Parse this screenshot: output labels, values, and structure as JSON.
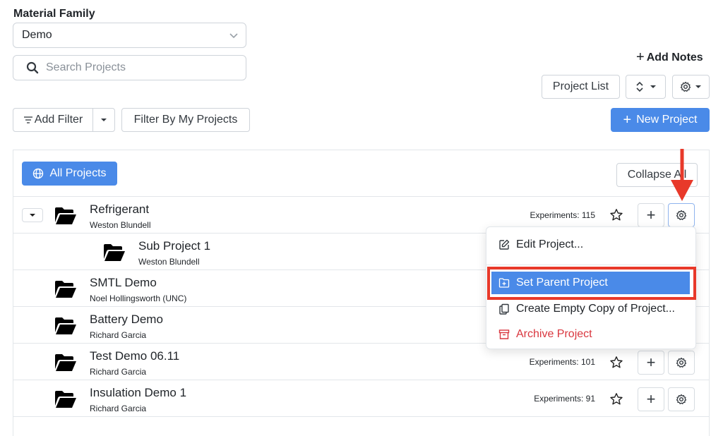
{
  "material_family": {
    "label": "Material Family",
    "selected": "Demo"
  },
  "search": {
    "placeholder": "Search Projects"
  },
  "add_notes_label": "Add Notes",
  "toolbar": {
    "project_list_label": "Project List"
  },
  "filters": {
    "add_filter_label": "Add Filter",
    "my_projects_label": "Filter By My Projects"
  },
  "new_project_label": "New Project",
  "panel": {
    "all_projects_label": "All Projects",
    "collapse_all_label": "Collapse All"
  },
  "projects": [
    {
      "name": "Refrigerant",
      "owner": "Weston Blundell",
      "experiments": "Experiments: 115"
    },
    {
      "name": "Sub Project 1",
      "owner": "Weston Blundell",
      "experiments": ""
    },
    {
      "name": "SMTL Demo",
      "owner": "Noel Hollingsworth (UNC)",
      "experiments": ""
    },
    {
      "name": "Battery Demo",
      "owner": "Richard Garcia",
      "experiments": ""
    },
    {
      "name": "Test Demo 06.11",
      "owner": "Richard Garcia",
      "experiments": "Experiments: 101"
    },
    {
      "name": "Insulation Demo 1",
      "owner": "Richard Garcia",
      "experiments": "Experiments: 91"
    }
  ],
  "context_menu": {
    "edit": "Edit Project...",
    "set_parent": "Set Parent Project",
    "copy": "Create Empty Copy of Project...",
    "archive": "Archive Project"
  },
  "colors": {
    "primary": "#4a8ae8",
    "highlight_border": "#e8392a",
    "danger": "#d9363e",
    "arrow": "#e8392a"
  }
}
